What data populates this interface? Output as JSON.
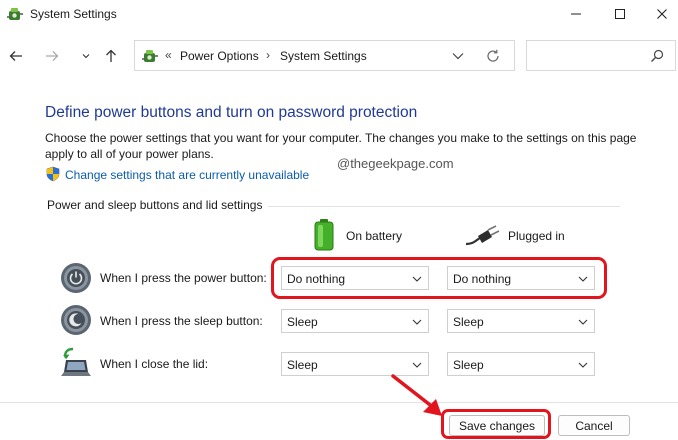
{
  "window": {
    "title": "System Settings"
  },
  "navigation": {
    "breadcrumbs": [
      "Power Options",
      "System Settings"
    ],
    "overflow_chevron": "«",
    "separator": "›"
  },
  "main": {
    "heading": "Define power buttons and turn on password protection",
    "description": "Choose the power settings that you want for your computer. The changes you make to the settings on this page apply to all of your power plans.",
    "change_link": "Change settings that are currently unavailable",
    "watermark": "@thegeekpage.com",
    "group_label": "Power and sleep buttons and lid settings"
  },
  "columns": {
    "battery": "On battery",
    "plugged": "Plugged in"
  },
  "rows": [
    {
      "label": "When I press the power button:",
      "icon": "power-button-icon",
      "battery": "Do nothing",
      "plugged": "Do nothing"
    },
    {
      "label": "When I press the sleep button:",
      "icon": "sleep-button-icon",
      "battery": "Sleep",
      "plugged": "Sleep"
    },
    {
      "label": "When I close the lid:",
      "icon": "laptop-lid-icon",
      "battery": "Sleep",
      "plugged": "Sleep"
    }
  ],
  "footer": {
    "save_label": "Save changes",
    "cancel_label": "Cancel"
  },
  "colors": {
    "heading": "#1f3a93",
    "link": "#0b5cad",
    "highlight": "#e2141e"
  }
}
